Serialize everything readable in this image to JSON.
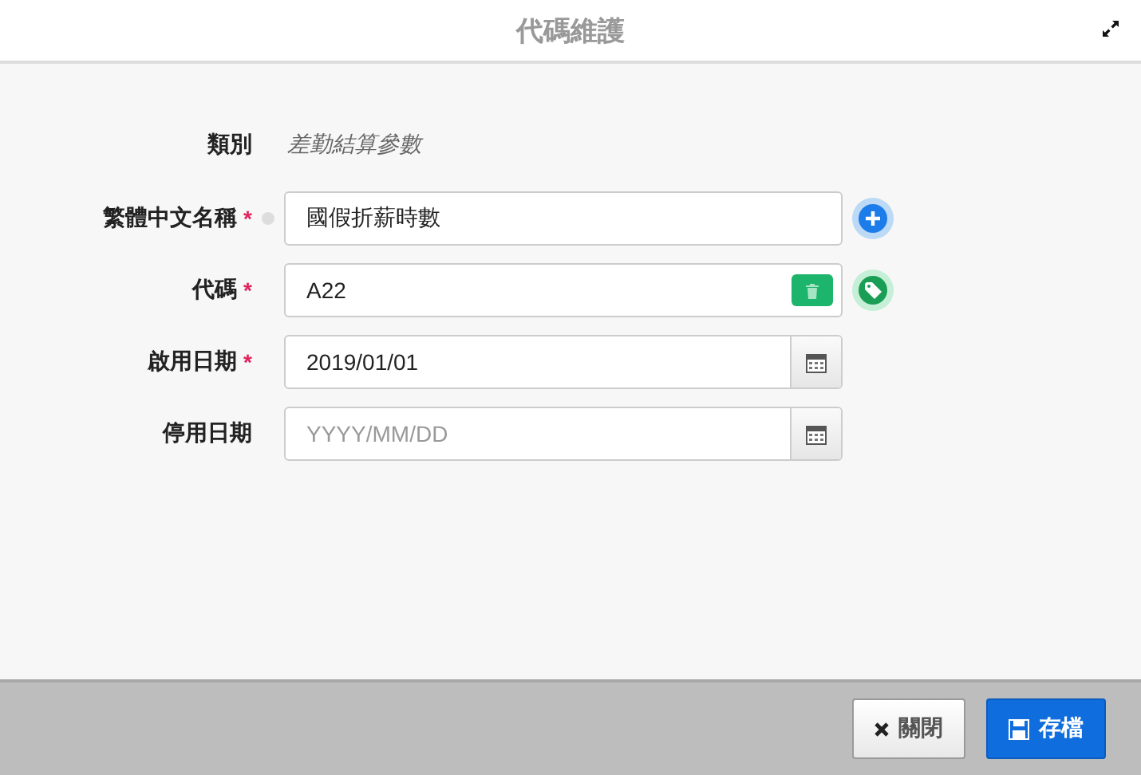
{
  "window": {
    "title": "代碼維護"
  },
  "category": {
    "label": "類別",
    "value": "差勤結算參數"
  },
  "fields": [
    {
      "label": "繁體中文名稱",
      "required_mark": "*",
      "info_dot": true,
      "kind": "addable",
      "value": "國假折薪時數"
    },
    {
      "label": "代碼",
      "required_mark": "*",
      "info_dot": false,
      "kind": "code",
      "value": "A22"
    },
    {
      "label": "啟用日期",
      "required_mark": "*",
      "info_dot": false,
      "kind": "date",
      "value": "2019/01/01"
    },
    {
      "label": "停用日期",
      "info_dot": false,
      "kind": "date",
      "placeholder": "YYYY/MM/DD"
    }
  ],
  "buttons": [
    {
      "label": "關閉",
      "kind": "close"
    },
    {
      "label": "存檔",
      "kind": "save"
    }
  ]
}
